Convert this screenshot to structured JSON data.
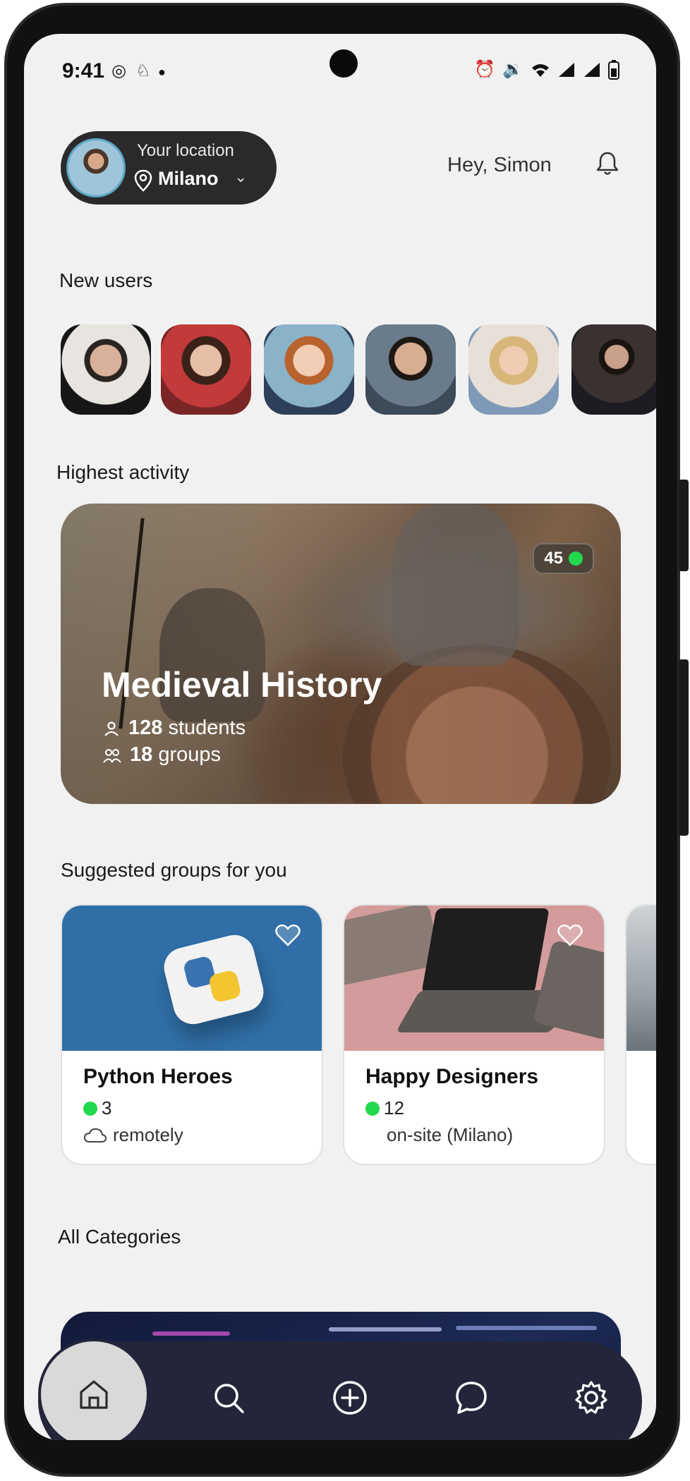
{
  "status_bar": {
    "time": "9:41"
  },
  "header": {
    "location_label": "Your location",
    "location_city": "Milano",
    "greeting": "Hey, Simon"
  },
  "new_users": {
    "title": "New users"
  },
  "highest_activity": {
    "title": "Highest activity",
    "card": {
      "online_count": "45",
      "title": "Medieval History",
      "students_count": "128",
      "students_label": "students",
      "groups_count": "18",
      "groups_label": "groups"
    }
  },
  "suggested_groups": {
    "title": "Suggested groups for you",
    "items": [
      {
        "title": "Python Heroes",
        "count": "3",
        "mode": "remotely"
      },
      {
        "title": "Happy Designers",
        "count": "12",
        "mode": "on-site (Milano)"
      }
    ]
  },
  "categories": {
    "title": "All Categories"
  },
  "colors": {
    "accent_green": "#22d84d",
    "nav_bg": "#24253a",
    "screen_bg": "#f1f1f1"
  },
  "nav": {
    "icons": [
      "home-icon",
      "search-icon",
      "add-circle-icon",
      "chat-icon",
      "settings-icon"
    ]
  }
}
